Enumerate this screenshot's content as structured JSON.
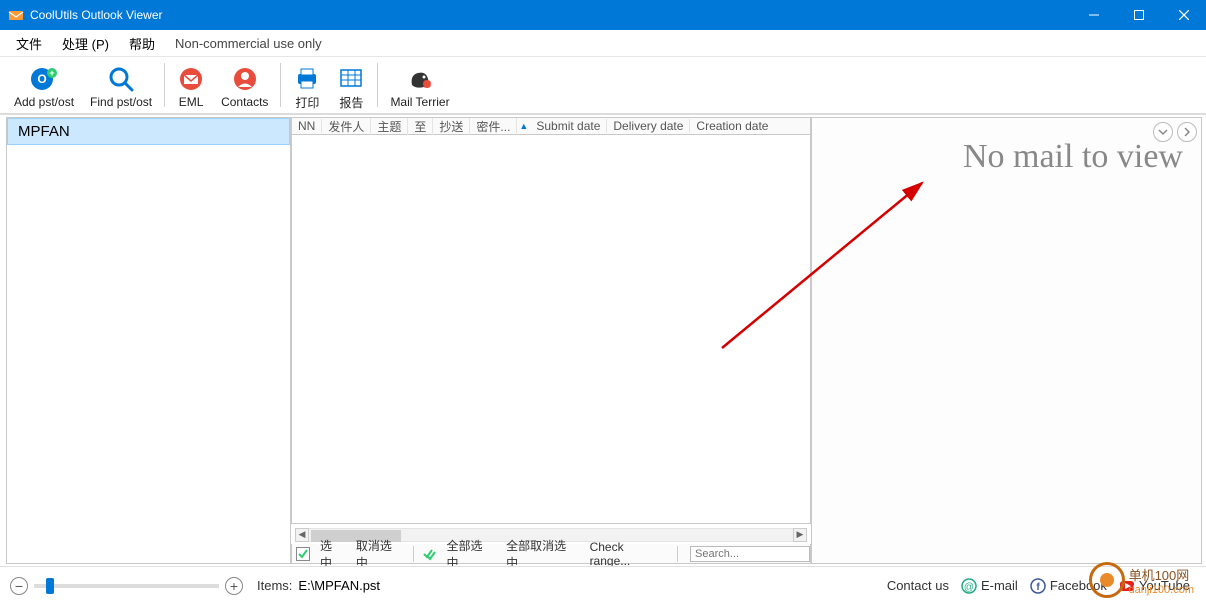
{
  "title": "CoolUtils Outlook Viewer",
  "menu": {
    "file": "文件",
    "process": "处理 (P)",
    "help": "帮助",
    "license": "Non-commercial use only"
  },
  "toolbar": {
    "add_pst": "Add pst/ost",
    "find_pst": "Find pst/ost",
    "eml": "EML",
    "contacts": "Contacts",
    "print": "打印",
    "report": "报告",
    "mail_terrier": "Mail Terrier"
  },
  "sidebar": {
    "folder": "MPFAN"
  },
  "columns": {
    "nn": "NN",
    "sender": "发件人",
    "subject": "主题",
    "to": "至",
    "cc": "抄送",
    "bcc": "密件...",
    "submit_date": "Submit date",
    "delivery_date": "Delivery date",
    "creation_date": "Creation date"
  },
  "footer": {
    "select": "选中",
    "deselect": "取消选中",
    "select_all": "全部选中",
    "deselect_all": "全部取消选中",
    "check_range": "Check range...",
    "search_placeholder": "Search..."
  },
  "preview": {
    "empty": "No mail to view"
  },
  "status": {
    "items_label": "Items:",
    "path": "E:\\MPFAN.pst",
    "contact_us": "Contact us",
    "email": "E-mail",
    "facebook": "Facebook",
    "youtube": "YouTube"
  },
  "watermark": {
    "text1": "单机100网",
    "text2": "danji100.com"
  }
}
